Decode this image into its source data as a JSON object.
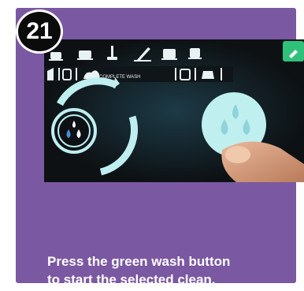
{
  "step": {
    "number": "21"
  },
  "screen": {
    "mode_bar": {
      "selected_mode_label": "COMPLETE WASH"
    },
    "icons": {
      "top_row": [
        "espresso-icon",
        "coffee-icon",
        "milk-icon",
        "steam-icon",
        "hot-water-icon",
        "settings-icon"
      ],
      "mode_row": [
        "rinse-icon",
        "cup-icon",
        "milk-system-icon",
        "cup-icon",
        "milk-jug-icon"
      ],
      "left_dial": "rinse-drops-icon",
      "wash_button": "wash-drops-icon",
      "corner": "wrench-icon"
    },
    "colors": {
      "wash_button": "#bff0ef",
      "corner_button": "#2fc17a",
      "rings": "#bfeef0"
    }
  },
  "caption": {
    "line1": "Press the green wash button",
    "line2": "to start the selected clean."
  }
}
